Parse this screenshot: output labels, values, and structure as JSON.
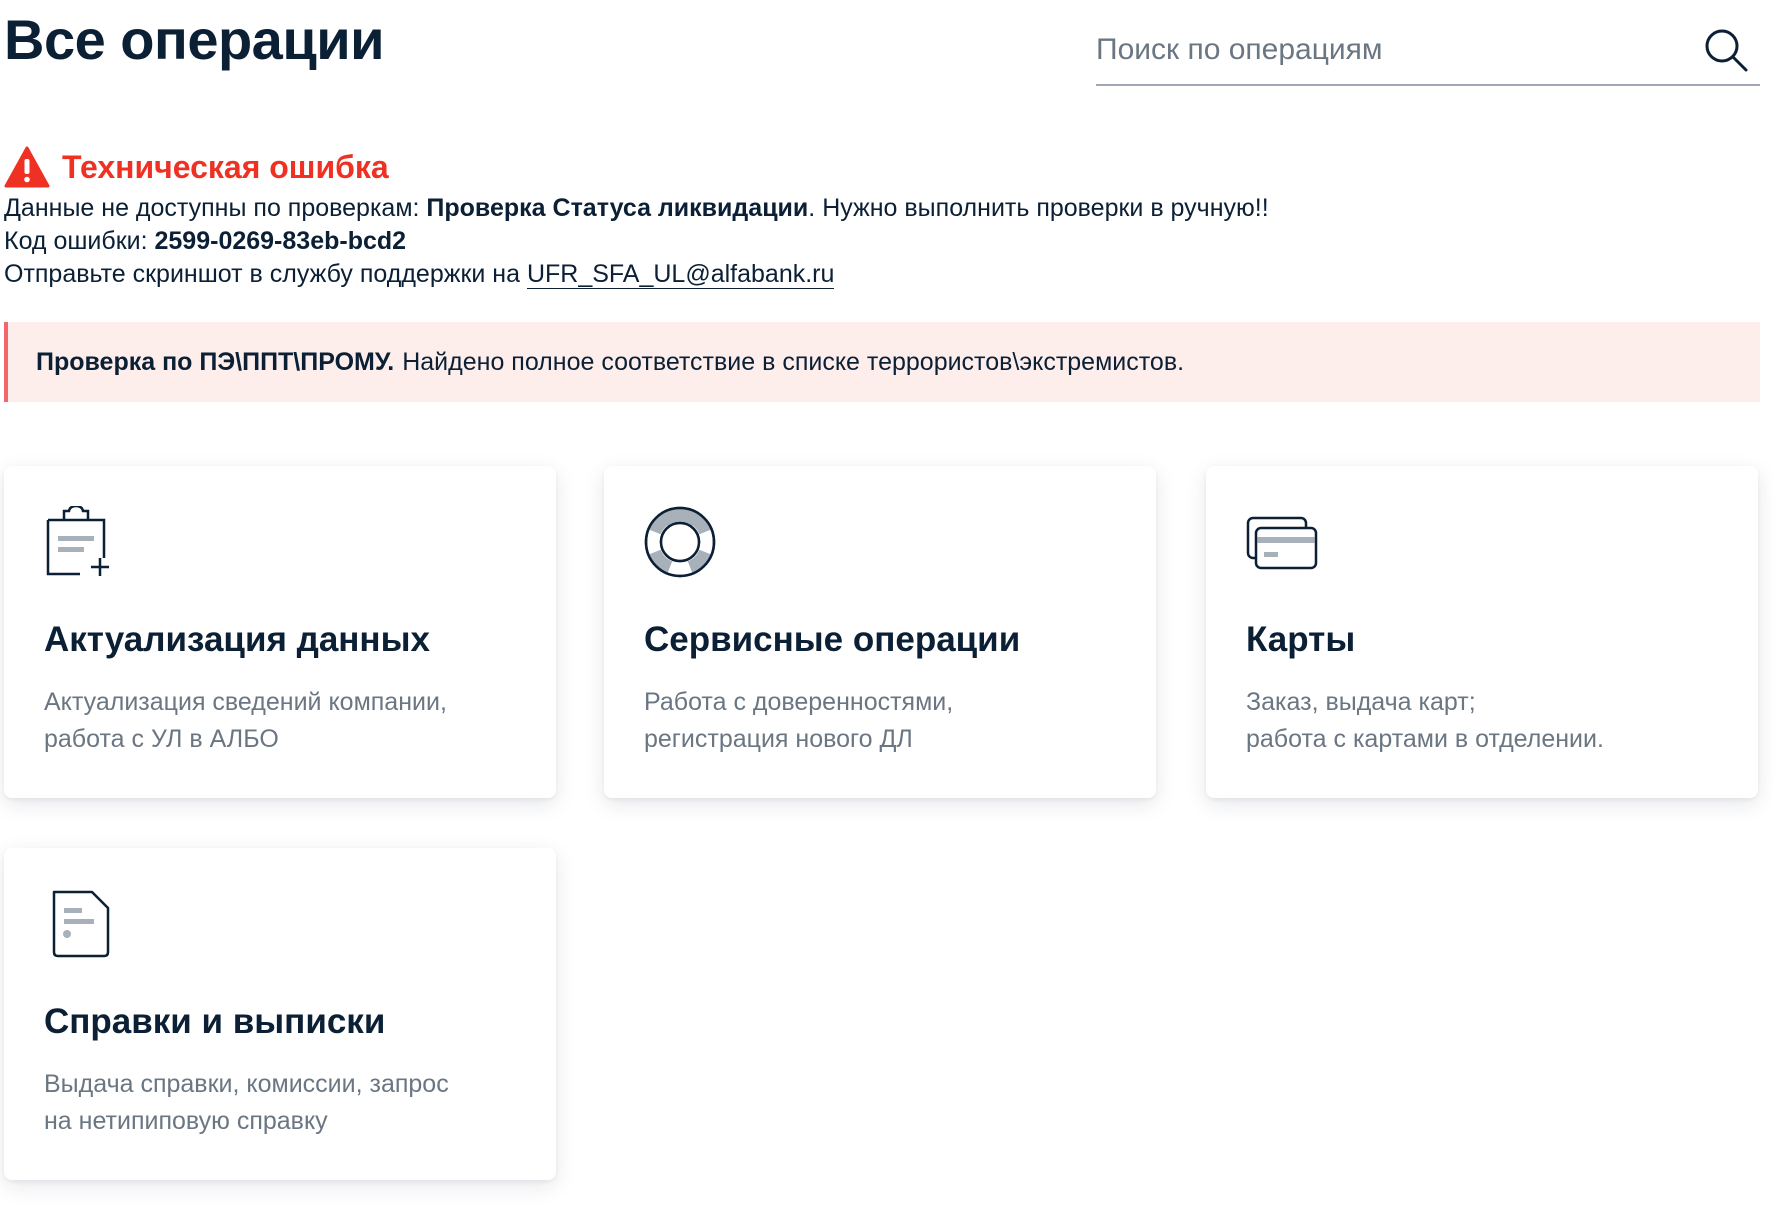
{
  "header": {
    "title": "Все операции",
    "search_placeholder": "Поиск по операциям",
    "search_icon": "search-icon"
  },
  "error": {
    "title": "Техническая ошибка",
    "icon": "warning-icon",
    "line1_prefix": "Данные не доступны по проверкам: ",
    "line1_bold": "Проверка Статуса ликвидации",
    "line1_suffix": ". Нужно выполнить проверки в ручную!!",
    "code_label": "Код ошибки: ",
    "code_value": "2599-0269-83eb-bcd2",
    "support_prefix": "Отправьте скриншот в службу поддержки на ",
    "support_email": "UFR_SFA_UL@alfabank.ru"
  },
  "alert": {
    "bold": "Проверка по ПЭ\\ППТ\\ПРОМУ.",
    "text": "Найдено полное соответствие в списке террористов\\экстремистов."
  },
  "cards": [
    {
      "icon": "clipboard-plus-icon",
      "title": "Актуализация данных",
      "desc_line1": "Актуализация сведений компании,",
      "desc_line2": "работа с УЛ в АЛБО"
    },
    {
      "icon": "lifebuoy-icon",
      "title": "Сервисные операции",
      "desc_line1": "Работа с доверенностями,",
      "desc_line2": "регистрация нового ДЛ"
    },
    {
      "icon": "cards-icon",
      "title": "Карты",
      "desc_line1": "Заказ, выдача карт;",
      "desc_line2": "работа с картами в отделении."
    },
    {
      "icon": "document-icon",
      "title": "Справки и выписки",
      "desc_line1": "Выдача справки, комиссии, запрос",
      "desc_line2": "на нетипиповую справку"
    }
  ],
  "colors": {
    "text": "#0b1f35",
    "muted": "#6b7683",
    "error": "#ef3124",
    "alert_bg": "#fdeeeb",
    "alert_border": "#f0666a"
  }
}
